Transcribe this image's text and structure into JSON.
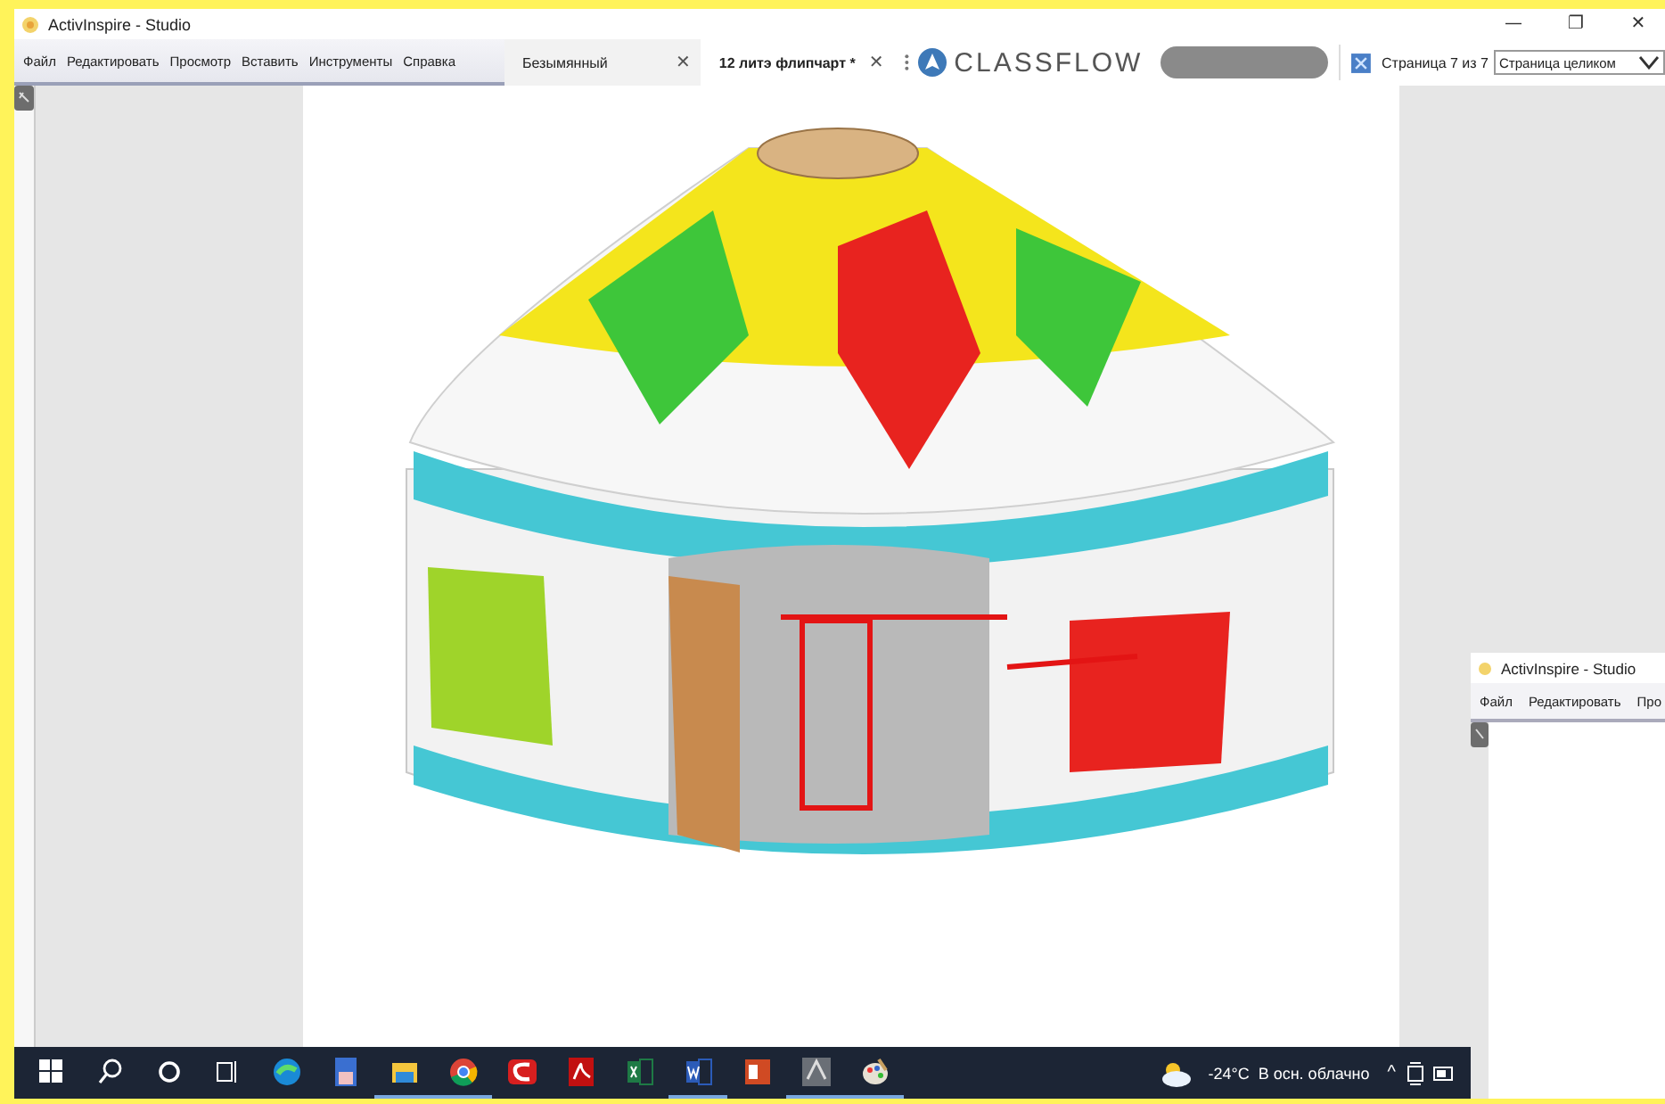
{
  "window": {
    "title": "ActivInspire - Studio",
    "controls": [
      "—",
      "❐",
      "✕"
    ]
  },
  "menu": [
    "Файл",
    "Редактировать",
    "Просмотр",
    "Вставить",
    "Инструменты",
    "Справка"
  ],
  "tabs": [
    {
      "label": "Безымянный",
      "selected": false,
      "close": "✕"
    },
    {
      "label": "12 литэ флипчарт *",
      "selected": true,
      "close": "✕"
    }
  ],
  "classflow": {
    "logo": "CLASSFLOW"
  },
  "page_indicator": "Страница 7 из 7",
  "zoom_select": {
    "value": "Страница целиком"
  },
  "second_window": {
    "title": "ActivInspire - Studio",
    "menu": [
      "Файл",
      "Редактировать",
      "Про"
    ]
  },
  "taskbar": {
    "apps": [
      {
        "kind": "start",
        "running": false
      },
      {
        "kind": "search",
        "running": false
      },
      {
        "kind": "cortana",
        "running": false
      },
      {
        "kind": "taskview",
        "running": false
      },
      {
        "kind": "edge",
        "running": false
      },
      {
        "kind": "floppy",
        "running": false
      },
      {
        "kind": "folder",
        "running": true
      },
      {
        "kind": "chrome",
        "running": true
      },
      {
        "kind": "redc",
        "running": false
      },
      {
        "kind": "pdf",
        "running": false
      },
      {
        "kind": "excel",
        "running": false
      },
      {
        "kind": "word",
        "running": true
      },
      {
        "kind": "ppt",
        "running": false
      },
      {
        "kind": "inspire",
        "running": true
      },
      {
        "kind": "paint",
        "running": true
      }
    ],
    "temperature": "-24°C",
    "weather": "В осн. облачно",
    "tray": "^"
  }
}
